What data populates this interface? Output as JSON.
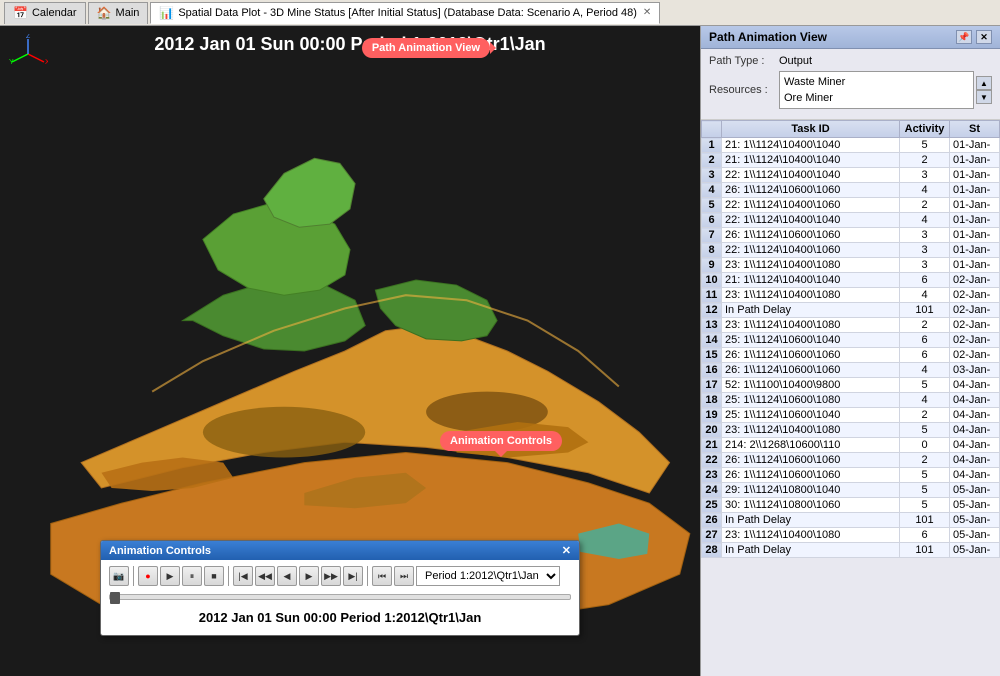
{
  "tabs": [
    {
      "id": "calendar",
      "label": "Calendar",
      "icon": "📅",
      "active": false
    },
    {
      "id": "main",
      "label": "Main",
      "icon": "🏠",
      "active": false
    },
    {
      "id": "spatial",
      "label": "Spatial Data Plot - 3D Mine Status [After Initial Status] (Database Data: Scenario A, Period 48)",
      "icon": "📊",
      "active": true,
      "closable": true
    }
  ],
  "view_header": "2012 Jan 01 Sun   00:00   Period 1:2012\\Qtr1\\Jan",
  "callout_anim": "Animation Controls",
  "callout_panel": "Path Animation View",
  "right_panel": {
    "title": "Path Animation View",
    "path_type_label": "Path Type :",
    "path_type_value": "Output",
    "resources_label": "Resources :",
    "resources": [
      "Waste Miner",
      "Ore Miner"
    ],
    "table": {
      "columns": [
        "",
        "Task ID",
        "Activity",
        "St"
      ],
      "rows": [
        {
          "num": "1",
          "task": "21: 1\\\\1124\\10400\\1040",
          "activity": "5",
          "sta": "01-Jan-"
        },
        {
          "num": "2",
          "task": "21: 1\\\\1124\\10400\\1040",
          "activity": "2",
          "sta": "01-Jan-"
        },
        {
          "num": "3",
          "task": "22: 1\\\\1124\\10400\\1040",
          "activity": "3",
          "sta": "01-Jan-"
        },
        {
          "num": "4",
          "task": "26: 1\\\\1124\\10600\\1060",
          "activity": "4",
          "sta": "01-Jan-"
        },
        {
          "num": "5",
          "task": "22: 1\\\\1124\\10400\\1060",
          "activity": "2",
          "sta": "01-Jan-"
        },
        {
          "num": "6",
          "task": "22: 1\\\\1124\\10400\\1040",
          "activity": "4",
          "sta": "01-Jan-"
        },
        {
          "num": "7",
          "task": "26: 1\\\\1124\\10600\\1060",
          "activity": "3",
          "sta": "01-Jan-"
        },
        {
          "num": "8",
          "task": "22: 1\\\\1124\\10400\\1060",
          "activity": "3",
          "sta": "01-Jan-"
        },
        {
          "num": "9",
          "task": "23: 1\\\\1124\\10400\\1080",
          "activity": "3",
          "sta": "01-Jan-"
        },
        {
          "num": "10",
          "task": "21: 1\\\\1124\\10400\\1040",
          "activity": "6",
          "sta": "02-Jan-"
        },
        {
          "num": "11",
          "task": "23: 1\\\\1124\\10400\\1080",
          "activity": "4",
          "sta": "02-Jan-"
        },
        {
          "num": "12",
          "task": "In Path Delay",
          "activity": "101",
          "sta": "02-Jan-"
        },
        {
          "num": "13",
          "task": "23: 1\\\\1124\\10400\\1080",
          "activity": "2",
          "sta": "02-Jan-"
        },
        {
          "num": "14",
          "task": "25: 1\\\\1124\\10600\\1040",
          "activity": "6",
          "sta": "02-Jan-"
        },
        {
          "num": "15",
          "task": "26: 1\\\\1124\\10600\\1060",
          "activity": "6",
          "sta": "02-Jan-"
        },
        {
          "num": "16",
          "task": "26: 1\\\\1124\\10600\\1060",
          "activity": "4",
          "sta": "03-Jan-"
        },
        {
          "num": "17",
          "task": "52: 1\\\\1100\\10400\\9800",
          "activity": "5",
          "sta": "04-Jan-"
        },
        {
          "num": "18",
          "task": "25: 1\\\\1124\\10600\\1080",
          "activity": "4",
          "sta": "04-Jan-"
        },
        {
          "num": "19",
          "task": "25: 1\\\\1124\\10600\\1040",
          "activity": "2",
          "sta": "04-Jan-"
        },
        {
          "num": "20",
          "task": "23: 1\\\\1124\\10400\\1080",
          "activity": "5",
          "sta": "04-Jan-"
        },
        {
          "num": "21",
          "task": "214: 2\\\\1268\\10600\\110",
          "activity": "0",
          "sta": "04-Jan-"
        },
        {
          "num": "22",
          "task": "26: 1\\\\1124\\10600\\1060",
          "activity": "2",
          "sta": "04-Jan-"
        },
        {
          "num": "23",
          "task": "26: 1\\\\1124\\10600\\1060",
          "activity": "5",
          "sta": "04-Jan-"
        },
        {
          "num": "24",
          "task": "29: 1\\\\1124\\10800\\1040",
          "activity": "5",
          "sta": "05-Jan-"
        },
        {
          "num": "25",
          "task": "30: 1\\\\1124\\10800\\1060",
          "activity": "5",
          "sta": "05-Jan-"
        },
        {
          "num": "26",
          "task": "In Path Delay",
          "activity": "101",
          "sta": "05-Jan-"
        },
        {
          "num": "27",
          "task": "23: 1\\\\1124\\10400\\1080",
          "activity": "6",
          "sta": "05-Jan-"
        },
        {
          "num": "28",
          "task": "In Path Delay",
          "activity": "101",
          "sta": "05-Jan-"
        }
      ]
    }
  },
  "anim_controls": {
    "title": "Animation Controls",
    "period_value": "Period 1:2012\\Qtr1\\Jan",
    "time_display": "2012 Jan 01 Sun   00:00   Period 1:2012\\Qtr1\\Jan",
    "buttons": [
      "camera",
      "record",
      "play",
      "pause",
      "stop",
      "prev-frame",
      "prev-fast",
      "prev-slow",
      "next-slow",
      "next-fast",
      "next-frame",
      "prev-period",
      "next-period"
    ]
  }
}
